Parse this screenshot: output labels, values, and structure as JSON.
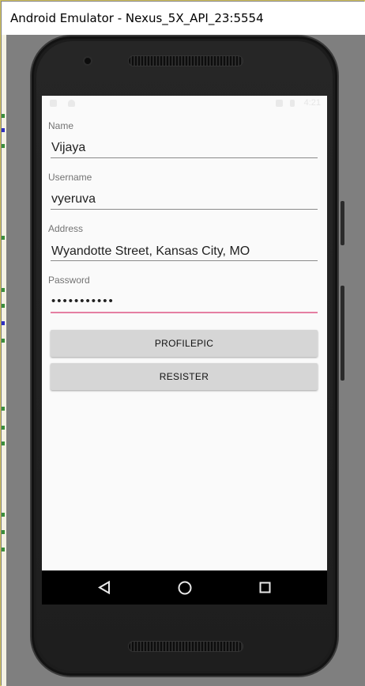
{
  "window": {
    "title": "Android Emulator - Nexus_5X_API_23:5554"
  },
  "status_bar": {
    "time": "4:21"
  },
  "form": {
    "name": {
      "label": "Name",
      "value": "Vijaya"
    },
    "username": {
      "label": "Username",
      "value": "vyeruva"
    },
    "address": {
      "label": "Address",
      "value": "Wyandotte Street, Kansas City, MO"
    },
    "password": {
      "label": "Password",
      "value": "•••••••••••"
    },
    "profilepic_button": "PROFILEPIC",
    "register_button": "RESISTER"
  },
  "nav": {
    "back_icon": "back-triangle-icon",
    "home_icon": "home-circle-icon",
    "recent_icon": "recent-square-icon"
  },
  "colors": {
    "active_underline": "#e57fa2",
    "button_bg": "#d6d6d6",
    "screen_bg": "#fafafa",
    "navbar_bg": "#000000"
  }
}
